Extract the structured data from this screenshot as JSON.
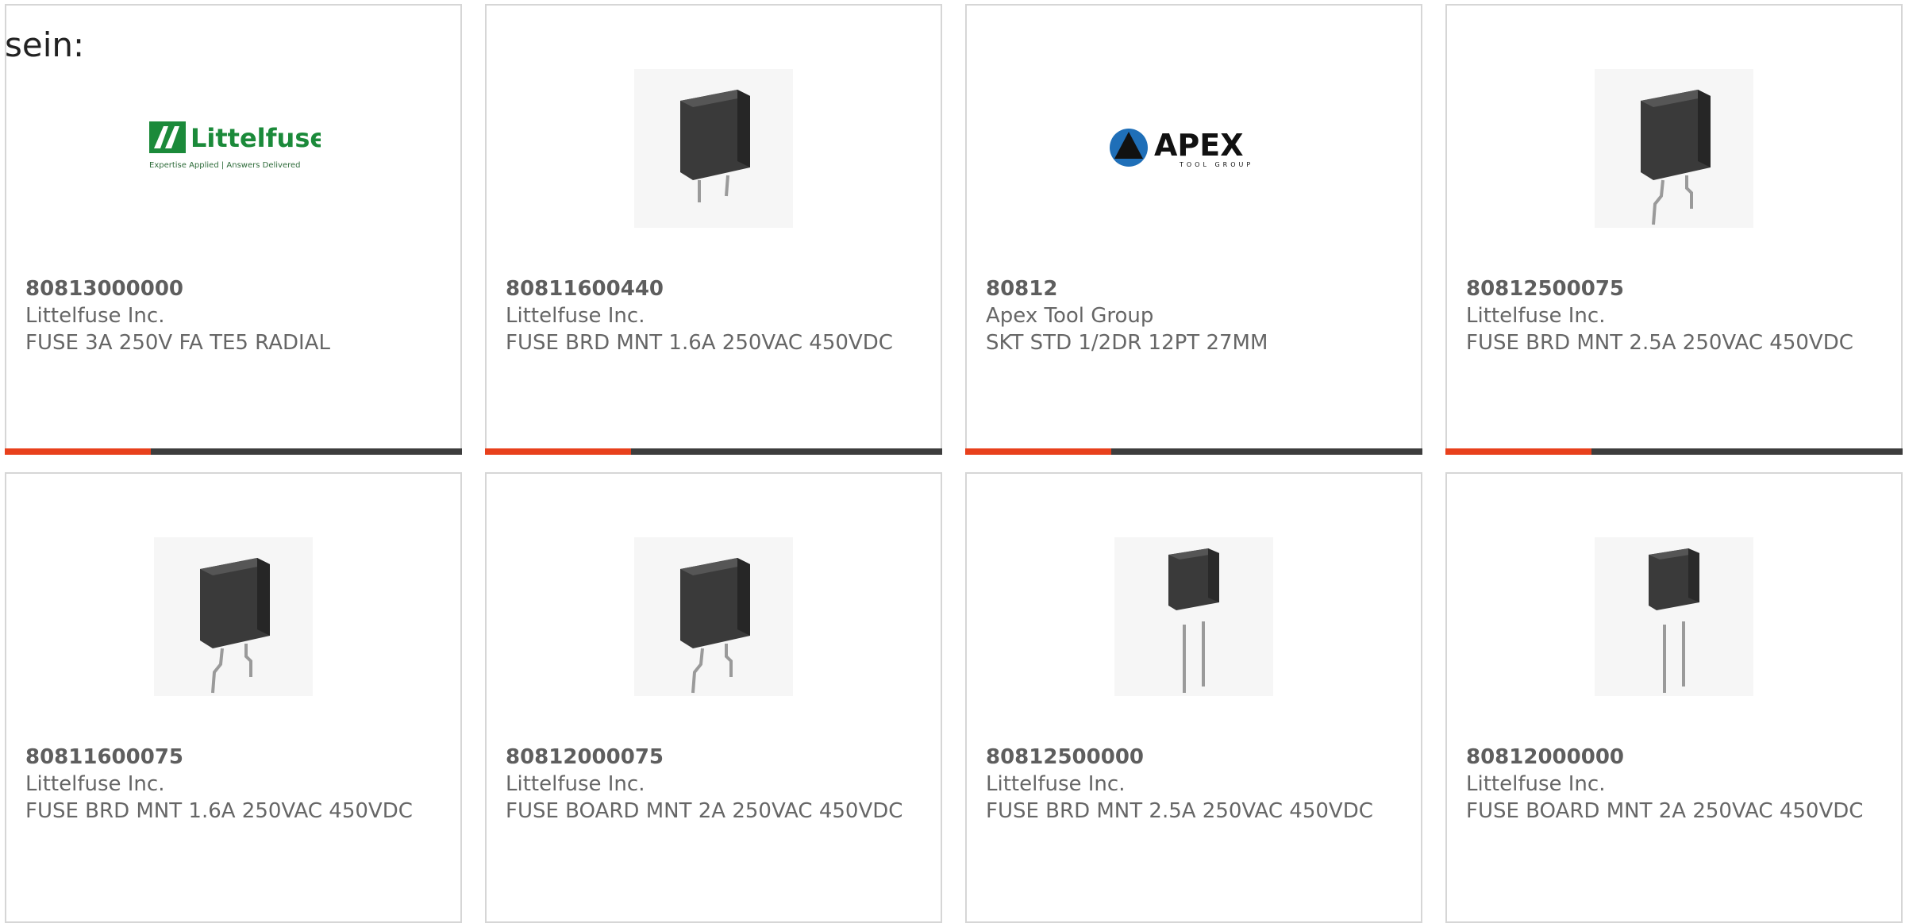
{
  "intro_text": "sein:",
  "accent_color": "#e8401c",
  "bar_color": "#3d3d3d",
  "products": [
    {
      "part": "80813000000",
      "mfr": "Littelfuse Inc.",
      "desc": "FUSE 3A 250V FA TE5 RADIAL",
      "image": "littelfuse-logo",
      "logo": {
        "brand": "Littelfuse",
        "tagline": "Expertise Applied | Answers Delivered"
      }
    },
    {
      "part": "80811600440",
      "mfr": "Littelfuse Inc.",
      "desc": "FUSE BRD MNT 1.6A 250VAC 450VDC",
      "image": "fuse-short-leads"
    },
    {
      "part": "80812",
      "mfr": "Apex Tool Group",
      "desc": "SKT STD 1/2DR 12PT 27MM",
      "image": "apex-logo",
      "logo": {
        "brand": "APEX",
        "tagline": "TOOL GROUP"
      }
    },
    {
      "part": "80812500075",
      "mfr": "Littelfuse Inc.",
      "desc": "FUSE BRD MNT 2.5A 250VAC 450VDC",
      "image": "fuse-bent-leads"
    },
    {
      "part": "80811600075",
      "mfr": "Littelfuse Inc.",
      "desc": "FUSE BRD MNT 1.6A 250VAC 450VDC",
      "image": "fuse-bent-leads"
    },
    {
      "part": "80812000075",
      "mfr": "Littelfuse Inc.",
      "desc": "FUSE BOARD MNT 2A 250VAC 450VDC",
      "image": "fuse-bent-leads"
    },
    {
      "part": "80812500000",
      "mfr": "Littelfuse Inc.",
      "desc": "FUSE BRD MNT 2.5A 250VAC 450VDC",
      "image": "fuse-long-leads"
    },
    {
      "part": "80812000000",
      "mfr": "Littelfuse Inc.",
      "desc": "FUSE BOARD MNT 2A 250VAC 450VDC",
      "image": "fuse-long-leads"
    }
  ]
}
